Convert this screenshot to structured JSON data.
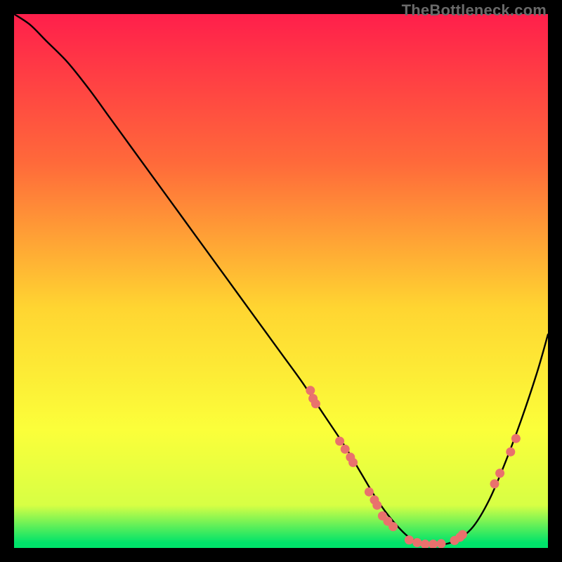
{
  "watermark": "TheBottleneck.com",
  "colors": {
    "gradient_top": "#ff1f4b",
    "gradient_mid_upper": "#ff6a3a",
    "gradient_mid": "#ffd531",
    "gradient_mid_lower": "#fbff3a",
    "gradient_lower": "#d7ff44",
    "gradient_bottom": "#00e36a",
    "curve": "#000000",
    "marker": "#e9716d",
    "frame_bg": "#000000"
  },
  "chart_data": {
    "type": "line",
    "title": "",
    "xlabel": "",
    "ylabel": "",
    "xlim": [
      0,
      100
    ],
    "ylim": [
      0,
      100
    ],
    "grid": false,
    "legend": false,
    "series": [
      {
        "name": "bottleneck-curve",
        "x": [
          0,
          3,
          6,
          10,
          14,
          18,
          22,
          26,
          30,
          34,
          38,
          42,
          46,
          50,
          54,
          58,
          62,
          65,
          68,
          71,
          74,
          77,
          80,
          83,
          86,
          89,
          92,
          95,
          98,
          100
        ],
        "y": [
          100,
          98,
          95,
          91,
          86,
          80.5,
          75,
          69.5,
          64,
          58.5,
          53,
          47.5,
          42,
          36.5,
          31,
          25,
          19,
          14,
          9,
          5,
          2,
          0.8,
          0.6,
          1.5,
          4,
          9,
          16,
          24,
          33,
          40
        ]
      }
    ],
    "markers": {
      "name": "highlighted-points",
      "points": [
        {
          "x": 55.5,
          "y": 29.5
        },
        {
          "x": 56.0,
          "y": 28.0
        },
        {
          "x": 56.5,
          "y": 27.0
        },
        {
          "x": 61.0,
          "y": 20.0
        },
        {
          "x": 62.0,
          "y": 18.5
        },
        {
          "x": 63.0,
          "y": 17.0
        },
        {
          "x": 63.5,
          "y": 16.0
        },
        {
          "x": 66.5,
          "y": 10.5
        },
        {
          "x": 67.5,
          "y": 9.0
        },
        {
          "x": 68.0,
          "y": 8.0
        },
        {
          "x": 69.0,
          "y": 6.0
        },
        {
          "x": 70.0,
          "y": 5.0
        },
        {
          "x": 71.0,
          "y": 4.0
        },
        {
          "x": 74.0,
          "y": 1.5
        },
        {
          "x": 75.5,
          "y": 1.0
        },
        {
          "x": 77.0,
          "y": 0.7
        },
        {
          "x": 78.5,
          "y": 0.7
        },
        {
          "x": 80.0,
          "y": 0.8
        },
        {
          "x": 82.5,
          "y": 1.4
        },
        {
          "x": 83.5,
          "y": 2.0
        },
        {
          "x": 84.0,
          "y": 2.5
        },
        {
          "x": 90.0,
          "y": 12.0
        },
        {
          "x": 91.0,
          "y": 14.0
        },
        {
          "x": 93.0,
          "y": 18.0
        },
        {
          "x": 94.0,
          "y": 20.5
        }
      ]
    }
  }
}
